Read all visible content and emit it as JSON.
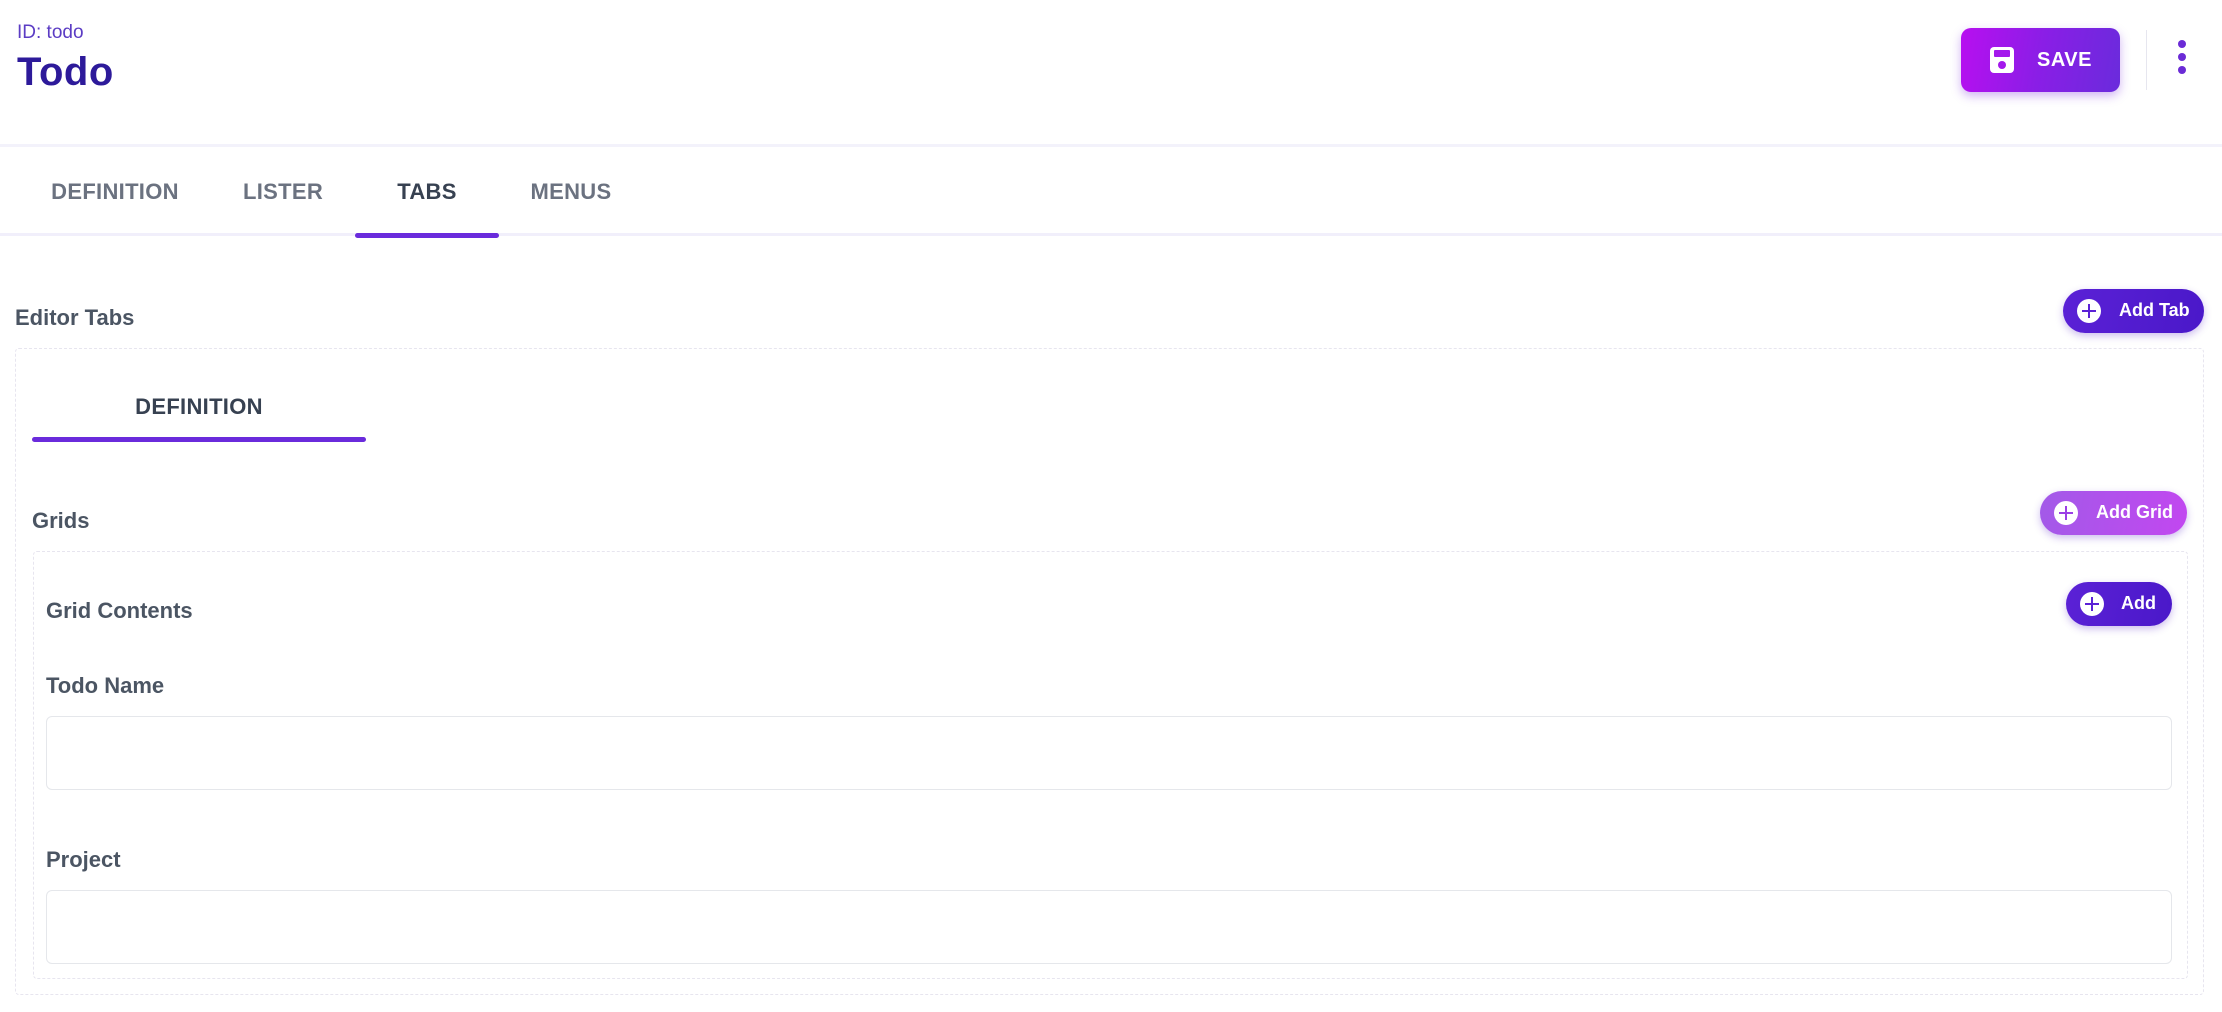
{
  "header": {
    "record_id": "ID: todo",
    "title": "Todo",
    "save_label": "SAVE"
  },
  "tabs": [
    {
      "label": "DEFINITION",
      "active": false
    },
    {
      "label": "LISTER",
      "active": false
    },
    {
      "label": "TABS",
      "active": true
    },
    {
      "label": "MENUS",
      "active": false
    }
  ],
  "editor_tabs": {
    "heading": "Editor Tabs",
    "add_tab_label": "Add Tab",
    "inner_tabs": [
      {
        "label": "DEFINITION",
        "active": true
      }
    ]
  },
  "grids": {
    "heading": "Grids",
    "add_grid_label": "Add Grid",
    "contents_heading": "Grid Contents",
    "add_label": "Add",
    "fields": [
      {
        "label": "Todo Name",
        "value": "",
        "placeholder": ""
      },
      {
        "label": "Project",
        "value": "",
        "placeholder": ""
      }
    ]
  },
  "colors": {
    "accent": "#6a2bdc",
    "title": "#2d1a9a",
    "save_gradient_start": "#b80ff0",
    "add_grid_gradient": "#c247f0"
  },
  "icons": {
    "save": "floppy-disk-icon",
    "more": "kebab-menu-icon",
    "add": "plus-circle-icon"
  }
}
